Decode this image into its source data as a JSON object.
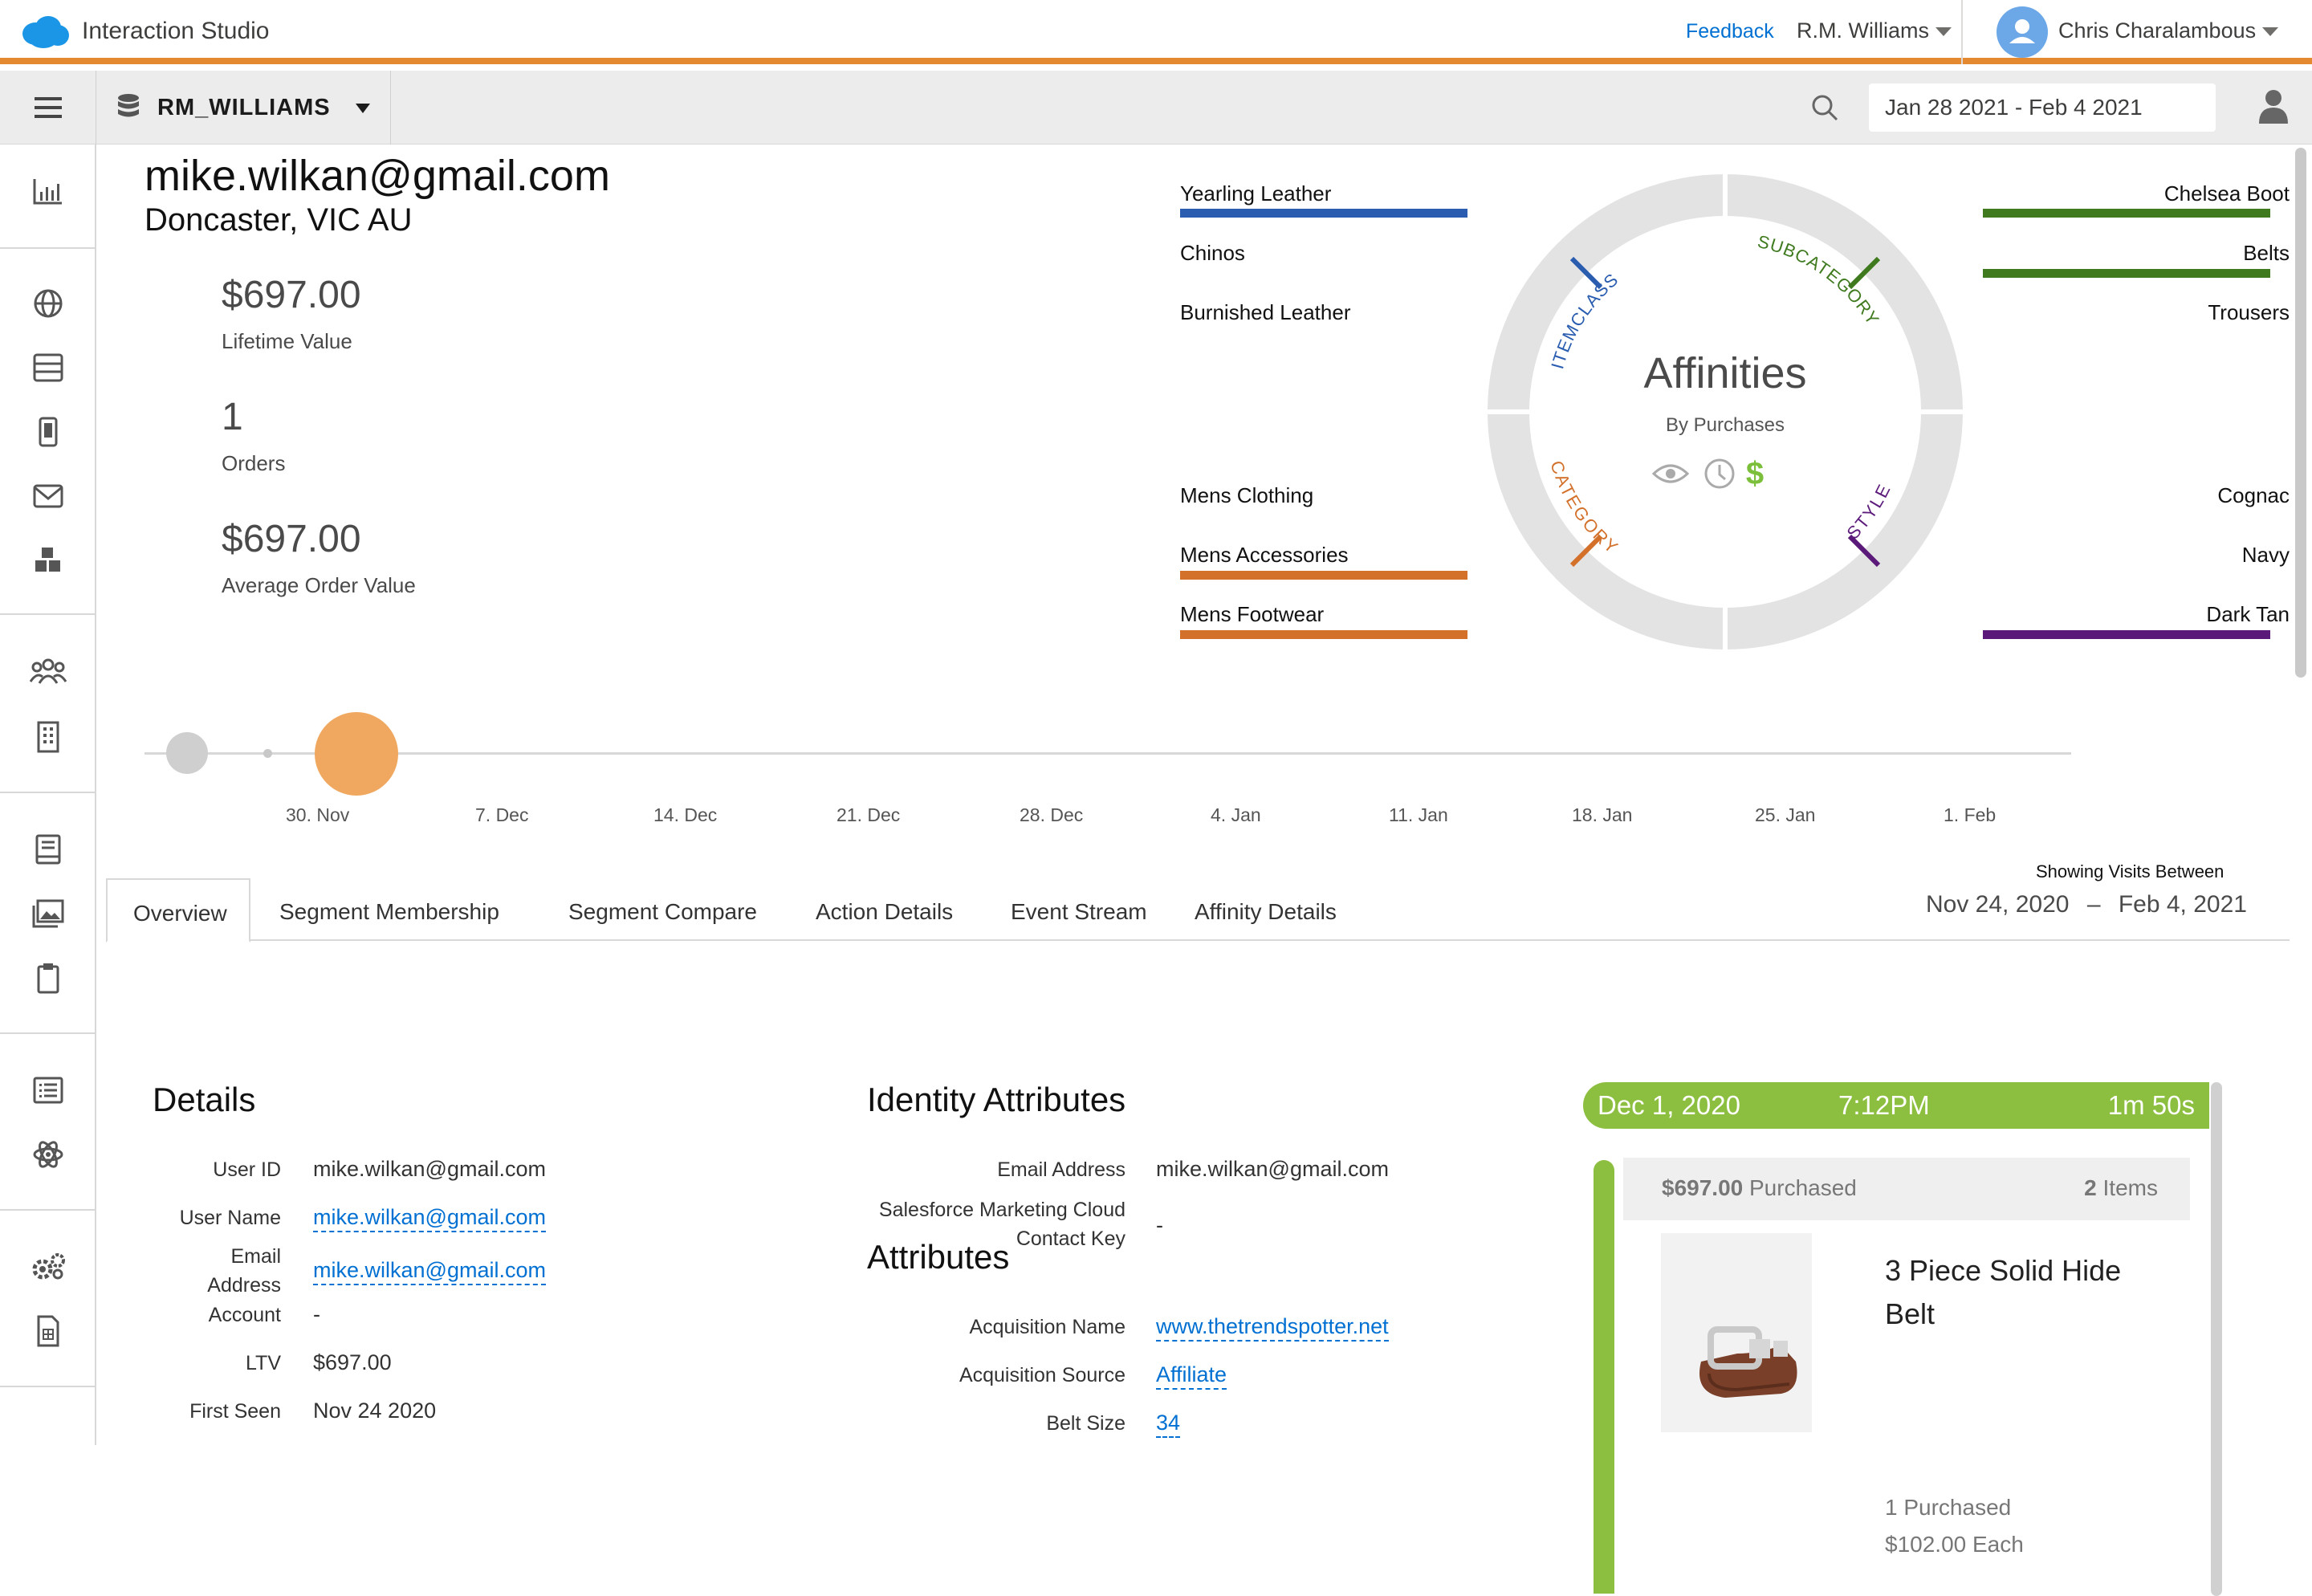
{
  "header": {
    "app_title": "Interaction Studio",
    "feedback": "Feedback",
    "account": "R.M. Williams",
    "user": "Chris Charalambous"
  },
  "subbar": {
    "dataset": "RM_WILLIAMS",
    "date_range": "Jan 28 2021 - Feb 4 2021"
  },
  "profile": {
    "email": "mike.wilkan@gmail.com",
    "location": "Doncaster, VIC AU",
    "stats": [
      {
        "value": "$697.00",
        "label": "Lifetime Value"
      },
      {
        "value": "1",
        "label": "Orders"
      },
      {
        "value": "$697.00",
        "label": "Average Order Value"
      }
    ]
  },
  "affinities": {
    "title": "Affinities",
    "subtitle": "By Purchases",
    "ring_labels": {
      "itemclass": "ITEMCLASS",
      "subcategory": "SUBCATEGORY",
      "category": "CATEGORY",
      "style": "STYLE"
    },
    "colors": {
      "itemclass": "#2a5db0",
      "subcategory": "#3f7a1f",
      "category": "#d3702a",
      "style": "#5b1a7a",
      "ring": "#e3e3e3",
      "dollar": "#7bbf3a"
    },
    "itemclass": [
      "Yearling Leather",
      "Chinos",
      "Burnished Leather"
    ],
    "subcategory": [
      "Chelsea Boot",
      "Belts",
      "Trousers"
    ],
    "category": [
      "Mens Clothing",
      "Mens Accessories",
      "Mens Footwear"
    ],
    "style": [
      "Cognac",
      "Navy",
      "Dark Tan"
    ]
  },
  "timeline": {
    "ticks": [
      "30. Nov",
      "7. Dec",
      "14. Dec",
      "21. Dec",
      "28. Dec",
      "4. Jan",
      "11. Jan",
      "18. Jan",
      "25. Jan",
      "1. Feb"
    ]
  },
  "tabs": [
    "Overview",
    "Segment Membership",
    "Segment Compare",
    "Action Details",
    "Event Stream",
    "Affinity Details"
  ],
  "showing": {
    "label": "Showing Visits Between",
    "start": "Nov 24, 2020",
    "sep": "–",
    "end": "Feb 4, 2021"
  },
  "details": {
    "title": "Details",
    "rows": [
      {
        "k": "User ID",
        "v": "mike.wilkan@gmail.com"
      },
      {
        "k": "User Name",
        "v": "mike.wilkan@gmail.com"
      },
      {
        "k1": "Email",
        "k2": "Address",
        "v": "mike.wilkan@gmail.com"
      },
      {
        "k": "Account",
        "v": "-"
      },
      {
        "k": "LTV",
        "v": "$697.00"
      },
      {
        "k": "First Seen",
        "v": "Nov 24 2020"
      }
    ]
  },
  "identity": {
    "title": "Identity Attributes",
    "email_k": "Email Address",
    "email_v": "mike.wilkan@gmail.com",
    "sfmc_k1": "Salesforce Marketing Cloud",
    "sfmc_k2": "Contact Key",
    "sfmc_v": "-"
  },
  "attributes": {
    "title": "Attributes",
    "rows": [
      {
        "k": "Acquisition Name",
        "v": "www.thetrendspotter.net"
      },
      {
        "k": "Acquisition Source",
        "v": "Affiliate"
      },
      {
        "k": "Belt Size",
        "v": "34"
      }
    ]
  },
  "visit": {
    "date": "Dec 1, 2020",
    "time": "7:12PM",
    "duration": "1m 50s",
    "purchased_amount": "$697.00",
    "purchased_word": "Purchased",
    "items_count": "2",
    "items_word": "Items",
    "product": {
      "name": "3 Piece Solid Hide Belt",
      "qty": "1 Purchased",
      "price": "$102.00 Each"
    }
  }
}
